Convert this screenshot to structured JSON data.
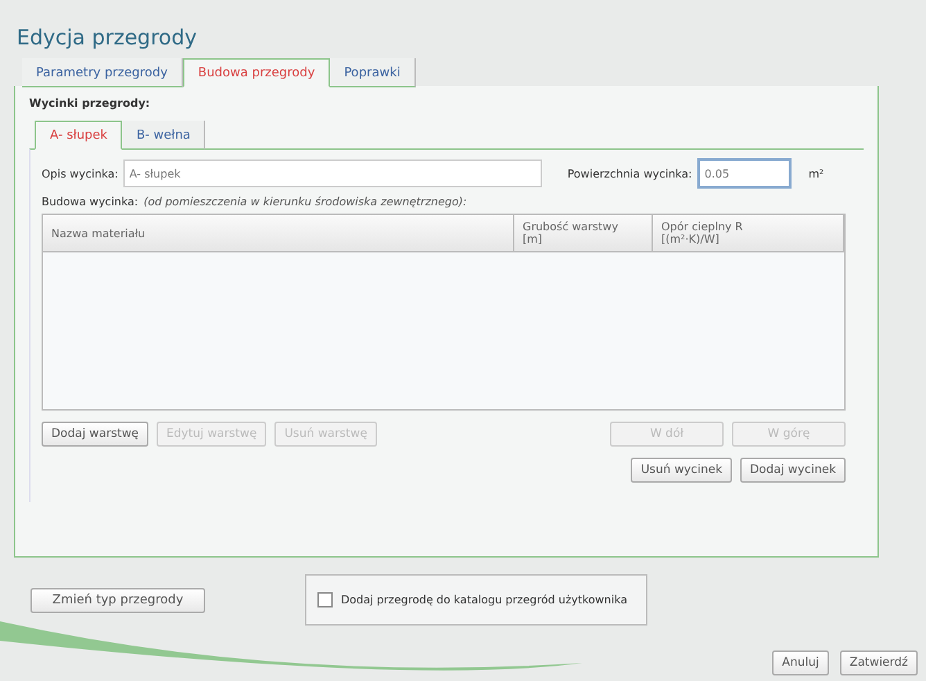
{
  "window": {
    "title": "Edycja przegrody"
  },
  "tabs": [
    {
      "label": "Parametry przegrody",
      "selected": false
    },
    {
      "label": "Budowa przegrody",
      "selected": true
    },
    {
      "label": "Poprawki",
      "selected": false
    }
  ],
  "section_label": "Wycinki przegrody:",
  "subtabs": [
    {
      "label": "A- słupek",
      "selected": true
    },
    {
      "label": "B- wełna",
      "selected": false
    }
  ],
  "description": {
    "label": "Opis wycinka:",
    "value": "A- słupek"
  },
  "area": {
    "label": "Powierzchnia wycinka:",
    "value": "0.05",
    "unit": "m²"
  },
  "structure": {
    "label": "Budowa wycinka:",
    "note": "(od pomieszczenia w kierunku środowiska zewnętrznego):"
  },
  "table": {
    "columns": [
      {
        "label": "Nazwa materiału"
      },
      {
        "label": "Grubość warstwy",
        "unit": "[m]"
      },
      {
        "label": "Opór cieplny R",
        "unit": "[(m²·K)/W]"
      }
    ]
  },
  "layer_buttons": [
    {
      "label": "Dodaj warstwę",
      "disabled": false
    },
    {
      "label": "Edytuj warstwę",
      "disabled": true
    },
    {
      "label": "Usuń warstwę",
      "disabled": true
    }
  ],
  "move_buttons": [
    {
      "label": "W dół",
      "disabled": true
    },
    {
      "label": "W górę",
      "disabled": true
    }
  ],
  "cut_buttons": [
    {
      "label": "Usuń wycinek",
      "disabled": false
    },
    {
      "label": "Dodaj wycinek",
      "disabled": false
    }
  ],
  "change_type_button": {
    "label": "Zmień typ przegrody",
    "disabled": false
  },
  "catalog_checkbox": {
    "label": "Dodaj przegrodę do katalogu przegród użytkownika",
    "checked": false
  },
  "dialog_buttons": [
    {
      "label": "Anuluj",
      "disabled": false
    },
    {
      "label": "Zatwierdź",
      "disabled": false
    }
  ]
}
